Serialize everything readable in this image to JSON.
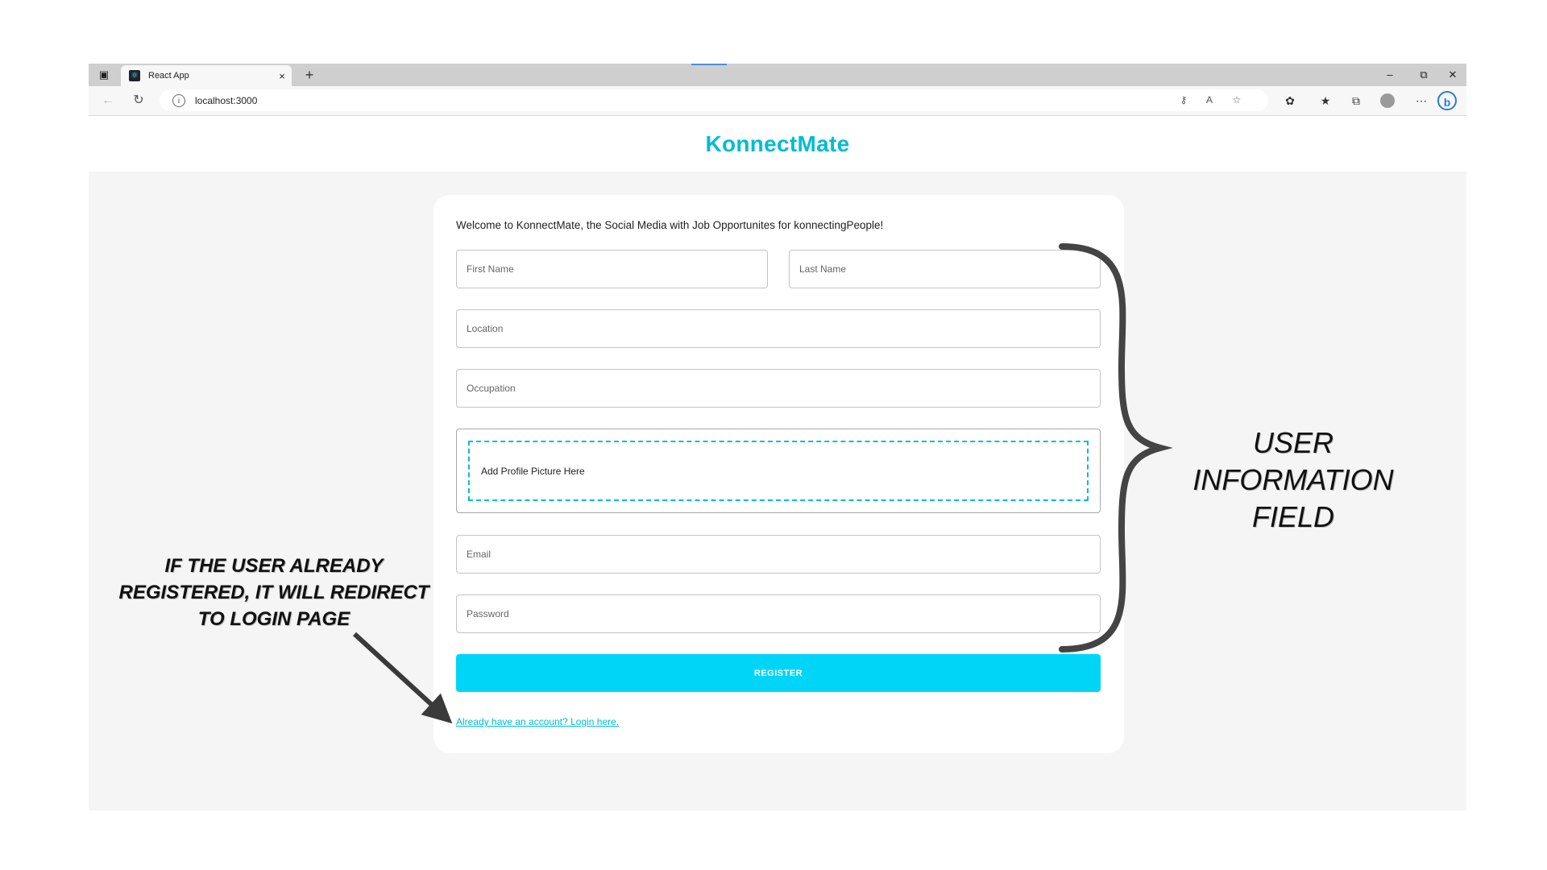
{
  "browser": {
    "tab_title": "React App",
    "tab_close": "×",
    "new_tab": "+",
    "url": "localhost:3000",
    "window": {
      "minimize": "–",
      "restore": "⧉",
      "close": "✕"
    }
  },
  "header": {
    "brand": "KonnectMate"
  },
  "form": {
    "welcome": "Welcome to KonnectMate, the Social Media with Job Opportunites for konnectingPeople!",
    "first_name_placeholder": "First Name",
    "last_name_placeholder": "Last Name",
    "location_placeholder": "Location",
    "occupation_placeholder": "Occupation",
    "picture_prompt": "Add Profile Picture Here",
    "email_placeholder": "Email",
    "password_placeholder": "Password",
    "register_label": "REGISTER",
    "login_link": "Already have an account? Login here."
  },
  "annotations": {
    "left_line1": "IF THE USER ALREADY",
    "left_line2": "REGISTERED, IT WILL REDIRECT",
    "left_line3": "TO LOGIN PAGE",
    "right_line1": "USER",
    "right_line2": "INFORMATION FIELD"
  },
  "colors": {
    "accent": "#00bcd4",
    "button": "#00d5f7",
    "page_bg": "#f5f5f5"
  }
}
